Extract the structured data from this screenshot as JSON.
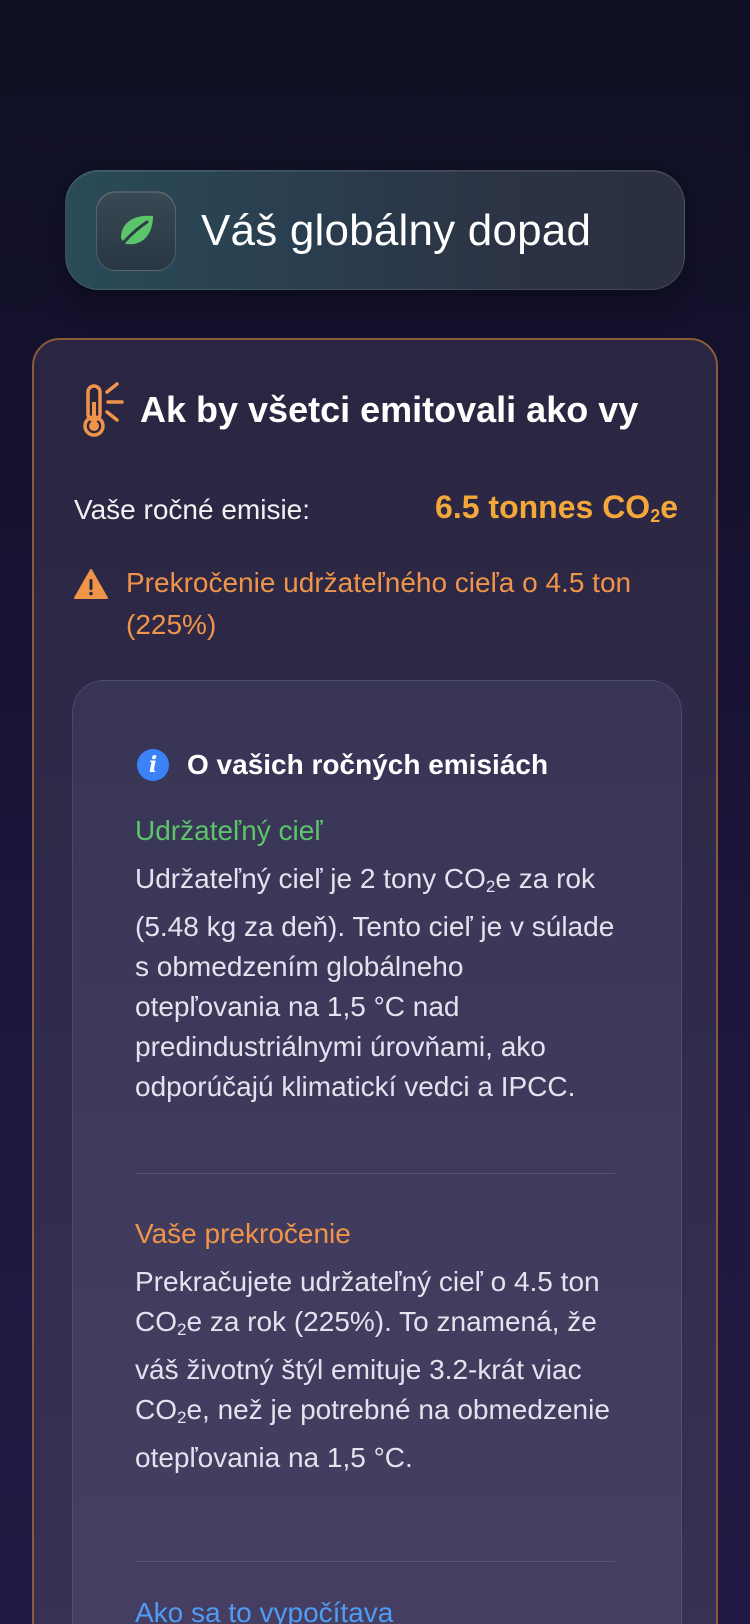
{
  "header": {
    "title": "Váš globálny dopad",
    "icon": "leaf-icon"
  },
  "card": {
    "title": "Ak by všetci emitovali ako vy",
    "annual_label": "Vaše ročné emisie:",
    "annual_value": "6.5 tonnes CO",
    "annual_value_sub": "2",
    "annual_value_suffix": "e",
    "warning": "Prekročenie udržateľného cieľa o 4.5 ton (225%)"
  },
  "info": {
    "title": "O vašich ročných emisiách",
    "sections": [
      {
        "heading": "Udržateľný cieľ",
        "text_a": "Udržateľný cieľ je 2 tony CO",
        "text_b": "e za rok (5.48 kg za deň). Tento cieľ je v súlade s obmedzením globálneho otepľovania na 1,5 °C nad predindustriálnymi úrovňami, ako odporúčajú klimatickí vedci a IPCC."
      },
      {
        "heading": "Vaše prekročenie",
        "text_a": "Prekračujete udržateľný cieľ o 4.5 ton CO",
        "text_b": "e za rok (225%). To znamená, že váš životný štýl emituje 3.2-krát viac CO",
        "text_c": "e, než je potrebné na obmedzenie otepľovania na 1,5 °C."
      },
      {
        "heading": "Ako sa to vypočítava"
      }
    ],
    "subscript": "2"
  },
  "colors": {
    "accent_orange": "#f5a83a",
    "warning_orange": "#f0944a",
    "green": "#5cc46a",
    "blue": "#3b82f6"
  }
}
